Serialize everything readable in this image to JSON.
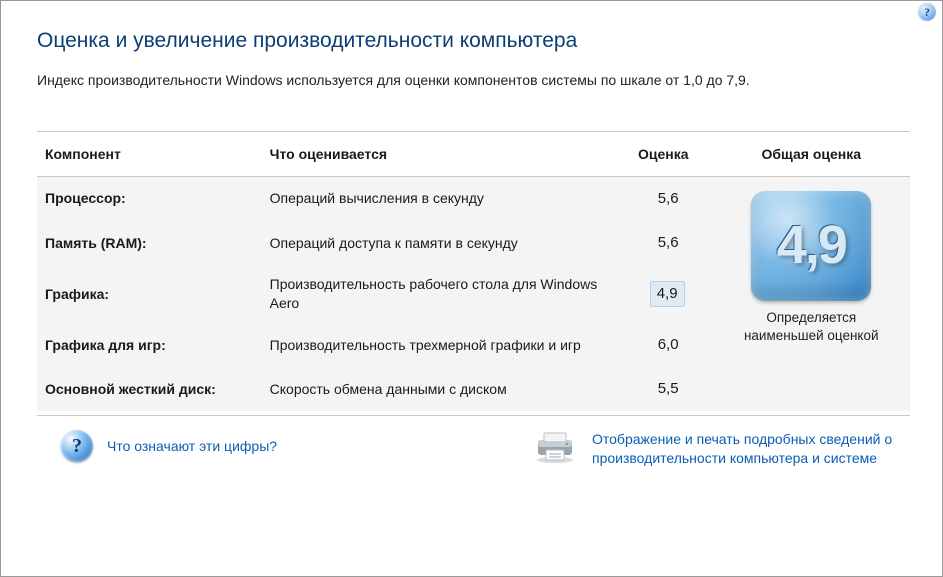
{
  "header": {
    "title": "Оценка и увеличение производительности компьютера",
    "description": "Индекс производительности Windows используется для оценки компонентов системы по шкале от 1,0 до 7,9."
  },
  "table": {
    "columns": {
      "component": "Компонент",
      "description": "Что оценивается",
      "score": "Оценка",
      "total": "Общая оценка"
    },
    "rows": [
      {
        "name": "Процессор:",
        "desc": "Операций вычисления в секунду",
        "score": "5,6",
        "lowest": false
      },
      {
        "name": "Память (RAM):",
        "desc": "Операций доступа к памяти в секунду",
        "score": "5,6",
        "lowest": false
      },
      {
        "name": "Графика:",
        "desc": "Производительность рабочего стола для Windows Aero",
        "score": "4,9",
        "lowest": true
      },
      {
        "name": "Графика для игр:",
        "desc": "Производительность трехмерной графики и игр",
        "score": "6,0",
        "lowest": false
      },
      {
        "name": "Основной жесткий диск:",
        "desc": "Скорость обмена данными с диском",
        "score": "5,5",
        "lowest": false
      }
    ],
    "base_score": "4,9",
    "base_caption": "Определяется наименьшей оценкой"
  },
  "footer": {
    "what_numbers_mean": "Что означают эти цифры?",
    "print_details": "Отображение и печать подробных сведений о производительности компьютера и системе"
  }
}
